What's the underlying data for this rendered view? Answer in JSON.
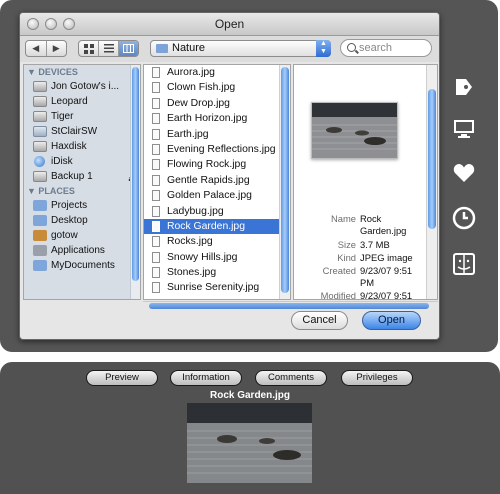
{
  "window": {
    "title": "Open"
  },
  "toolbar": {
    "back_glyph": "◀",
    "forward_glyph": "▶",
    "location": "Nature",
    "search_placeholder": "search"
  },
  "sidebar": {
    "devices_header": "DEVICES",
    "devices": [
      {
        "label": "Jon Gotow's i...",
        "icon": "computer-icon"
      },
      {
        "label": "Leopard",
        "icon": "hard-drive-icon"
      },
      {
        "label": "Tiger",
        "icon": "hard-drive-icon"
      },
      {
        "label": "StClairSW",
        "icon": "network-drive-icon"
      },
      {
        "label": "Haxdisk",
        "icon": "hard-drive-icon"
      },
      {
        "label": "iDisk",
        "icon": "idisk-icon"
      },
      {
        "label": "Backup 1",
        "icon": "hard-drive-icon"
      }
    ],
    "places_header": "PLACES",
    "places": [
      {
        "label": "Projects",
        "icon": "folder-icon"
      },
      {
        "label": "Desktop",
        "icon": "desktop-icon"
      },
      {
        "label": "gotow",
        "icon": "home-icon"
      },
      {
        "label": "Applications",
        "icon": "applications-icon"
      },
      {
        "label": "MyDocuments",
        "icon": "folder-icon"
      }
    ]
  },
  "files": [
    "Aurora.jpg",
    "Clown Fish.jpg",
    "Dew Drop.jpg",
    "Earth Horizon.jpg",
    "Earth.jpg",
    "Evening Reflections.jpg",
    "Flowing Rock.jpg",
    "Gentle Rapids.jpg",
    "Golden Palace.jpg",
    "Ladybug.jpg",
    "Rock Garden.jpg",
    "Rocks.jpg",
    "Snowy Hills.jpg",
    "Stones.jpg",
    "Sunrise Serenity.jpg"
  ],
  "selected_file_index": 10,
  "preview": {
    "name_label": "Name",
    "name_line1": "Rock",
    "name_line2": "Garden.jpg",
    "size_label": "Size",
    "size": "3.7 MB",
    "kind_label": "Kind",
    "kind": "JPEG image",
    "created_label": "Created",
    "created_line1": "9/23/07 9:51",
    "created_line2": "PM",
    "modified_label": "Modified",
    "modified_line1": "9/23/07 9:51"
  },
  "buttons": {
    "cancel": "Cancel",
    "open": "Open"
  },
  "bottom_tabs": [
    "Preview",
    "Information",
    "Comments",
    "Privileges"
  ],
  "bottom_caption": "Rock Garden.jpg",
  "colors": {
    "selection": "#3a75d6",
    "panel": "#555555",
    "accent": "#3d86e6"
  }
}
